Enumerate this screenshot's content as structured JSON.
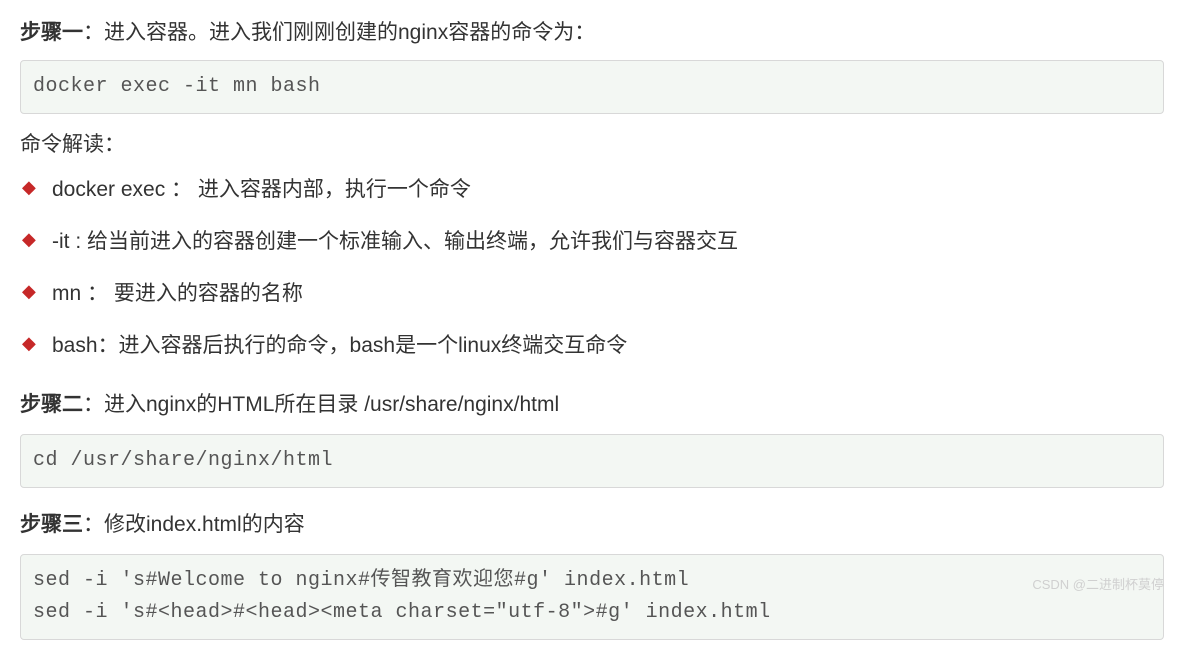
{
  "step1": {
    "label": "步骤一",
    "desc": "：进入容器。进入我们刚刚创建的nginx容器的命令为：",
    "code": "docker exec -it mn bash"
  },
  "explain": {
    "header": "命令解读：",
    "items": [
      "docker exec ： 进入容器内部，执行一个命令",
      "-it : 给当前进入的容器创建一个标准输入、输出终端，允许我们与容器交互",
      "mn ： 要进入的容器的名称",
      "bash：进入容器后执行的命令，bash是一个linux终端交互命令"
    ]
  },
  "step2": {
    "label": "步骤二",
    "desc": "：进入nginx的HTML所在目录 /usr/share/nginx/html",
    "code": "cd /usr/share/nginx/html"
  },
  "step3": {
    "label": "步骤三",
    "desc": "：修改index.html的内容",
    "code": "sed -i 's#Welcome to nginx#传智教育欢迎您#g' index.html\nsed -i 's#<head>#<head><meta charset=\"utf-8\">#g' index.html"
  },
  "watermark": "CSDN @二进制杯莫停"
}
